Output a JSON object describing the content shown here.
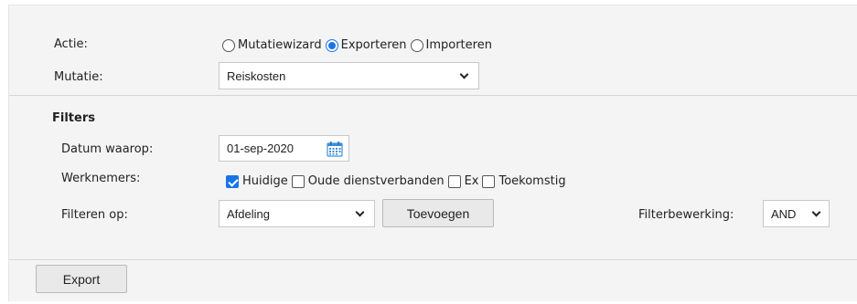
{
  "form": {
    "actie_label": "Actie:",
    "actie_options": [
      "Mutatiewizard",
      "Exporteren",
      "Importeren"
    ],
    "mutatie_label": "Mutatie:",
    "mutatie_value": "Reiskosten"
  },
  "filters": {
    "heading": "Filters",
    "datum_label": "Datum waarop:",
    "datum_value": "01-sep-2020",
    "werknemers_label": "Werknemers:",
    "werknemers_options": [
      "Huidige",
      "Oude dienstverbanden",
      "Ex",
      "Toekomstig"
    ],
    "filteren_label": "Filteren op:",
    "filteren_value": "Afdeling",
    "toevoegen_label": "Toevoegen",
    "bewerking_label": "Filterbewerking:",
    "bewerking_value": "AND"
  },
  "footer": {
    "export_label": "Export"
  },
  "colors": {
    "accent": "#1a73e8",
    "panel_bg": "#f4f4f4"
  }
}
